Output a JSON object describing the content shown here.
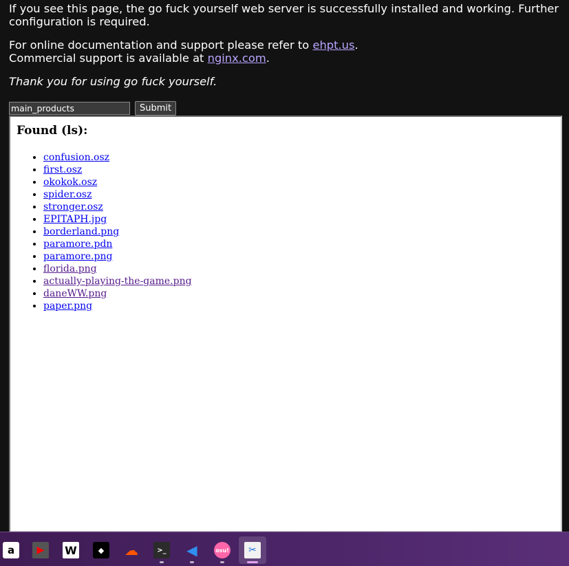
{
  "intro": {
    "line1": "If you see this page, the go fuck yourself web server is successfully installed and working. Further configuration is required.",
    "docs_prefix": "For online documentation and support please refer to ",
    "docs_link": "ehpt.us",
    "docs_suffix": ".",
    "commercial_prefix": "Commercial support is available at ",
    "commercial_link": "nginx.com",
    "commercial_suffix": ".",
    "thanks": "Thank you for using go fuck yourself."
  },
  "form": {
    "input_value": "main_products",
    "submit_label": "Submit"
  },
  "results": {
    "heading": "Found (ls):",
    "files": [
      {
        "name": "confusion.osz",
        "visited": false
      },
      {
        "name": "first.osz",
        "visited": false
      },
      {
        "name": "okokok.osz",
        "visited": false
      },
      {
        "name": "spider.osz",
        "visited": false
      },
      {
        "name": "stronger.osz",
        "visited": false
      },
      {
        "name": "EPITAPH.jpg",
        "visited": false
      },
      {
        "name": "borderland.png",
        "visited": false
      },
      {
        "name": "paramore.pdn",
        "visited": false
      },
      {
        "name": "paramore.png",
        "visited": false
      },
      {
        "name": "florida.png",
        "visited": true
      },
      {
        "name": "actually-playing-the-game.png",
        "visited": true
      },
      {
        "name": "daneWW.png",
        "visited": true
      },
      {
        "name": "paper.png",
        "visited": false
      }
    ]
  },
  "taskbar": {
    "apps": [
      {
        "id": "amazon",
        "icon": "amazon-icon",
        "glyph": "a",
        "running": false,
        "active": false
      },
      {
        "id": "youtube",
        "icon": "youtube-icon",
        "glyph": "▶",
        "running": false,
        "active": false
      },
      {
        "id": "wikipedia",
        "icon": "wikipedia-icon",
        "glyph": "W",
        "running": false,
        "active": false
      },
      {
        "id": "tidal",
        "icon": "tidal-icon",
        "glyph": "◆",
        "running": false,
        "active": false
      },
      {
        "id": "soundcloud",
        "icon": "soundcloud-icon",
        "glyph": "☁",
        "running": false,
        "active": false
      },
      {
        "id": "terminal",
        "icon": "terminal-icon",
        "glyph": ">_",
        "running": true,
        "active": false
      },
      {
        "id": "vscode",
        "icon": "vscode-icon",
        "glyph": "◀",
        "running": true,
        "active": false
      },
      {
        "id": "osu",
        "icon": "osu-icon",
        "glyph": "osu!",
        "running": true,
        "active": false
      },
      {
        "id": "snipping-tool",
        "icon": "snipping-tool-icon",
        "glyph": "✂",
        "running": true,
        "active": true
      }
    ]
  },
  "colors": {
    "page_bg": "#121212",
    "link_intro": "#b9a5ff",
    "link": "#0000ee",
    "link_visited": "#551a8b",
    "taskbar": "#4a2466"
  }
}
